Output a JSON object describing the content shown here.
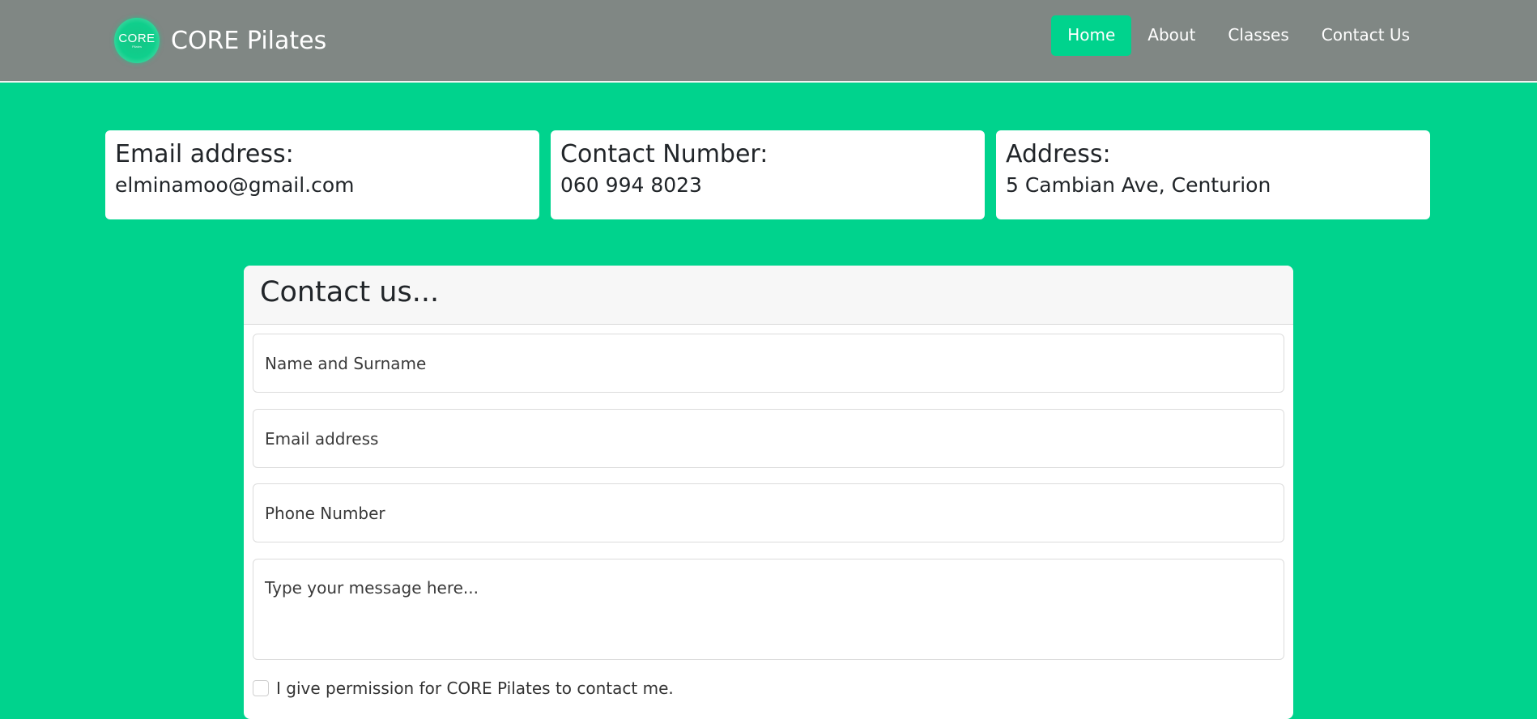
{
  "brand": {
    "logo_text": "CORE",
    "logo_subtext": "Pilates",
    "name": "CORE Pilates"
  },
  "nav": {
    "items": [
      {
        "label": "Home",
        "active": true
      },
      {
        "label": "About",
        "active": false
      },
      {
        "label": "Classes",
        "active": false
      },
      {
        "label": "Contact Us",
        "active": false
      }
    ]
  },
  "info": {
    "email": {
      "title": "Email address:",
      "value": "elminamoo@gmail.com"
    },
    "phone": {
      "title": "Contact Number:",
      "value": "060 994 8023"
    },
    "address": {
      "title": "Address:",
      "value": "5 Cambian Ave, Centurion"
    }
  },
  "form": {
    "title": "Contact us...",
    "name_placeholder": "Name and Surname",
    "email_placeholder": "Email address",
    "phone_placeholder": "Phone Number",
    "message_placeholder": "Type your message here...",
    "consent_label": "I give permission for CORE Pilates to contact me.",
    "consent_checked": false
  },
  "colors": {
    "accent": "#00d38d",
    "navbar": "#808784",
    "card": "#ffffff"
  }
}
